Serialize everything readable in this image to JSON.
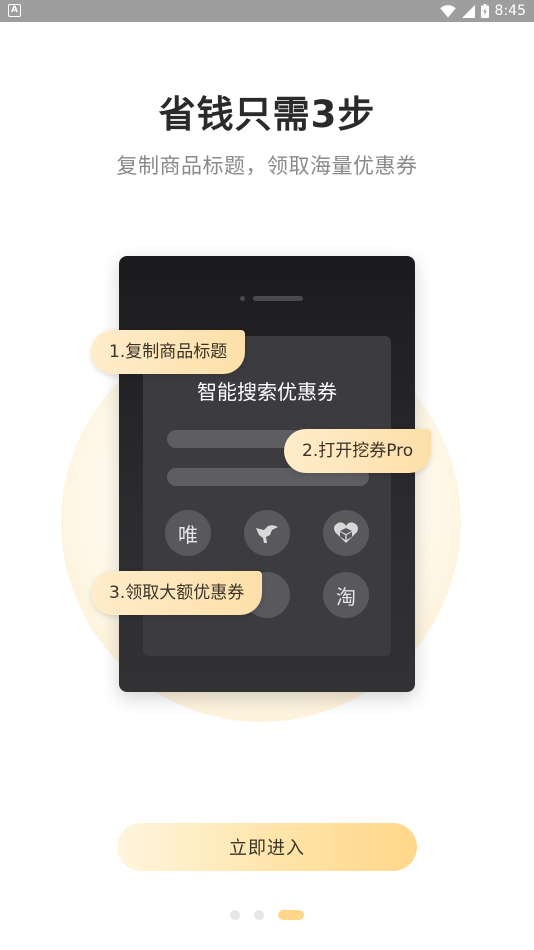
{
  "status_bar": {
    "time": "8:45",
    "app_icon_letter": "A",
    "icons": [
      "wifi-icon",
      "cellular-signal-icon",
      "battery-icon"
    ]
  },
  "header": {
    "title": "省钱只需3步",
    "subtitle": "复制商品标题，领取海量优惠券"
  },
  "phone": {
    "screen_title": "智能搜索优惠券",
    "apps": [
      {
        "label": "唯",
        "icon": "vip-icon"
      },
      {
        "label": "",
        "icon": "bird-icon"
      },
      {
        "label": "",
        "icon": "cube-logo-icon"
      },
      {
        "label": "",
        "icon": "app-icon-hidden"
      },
      {
        "label": "",
        "icon": "app-icon-hidden"
      },
      {
        "label": "淘",
        "icon": "taobao-icon"
      }
    ]
  },
  "steps": [
    {
      "label": "1.复制商品标题"
    },
    {
      "label": "2.打开挖券Pro"
    },
    {
      "label": "3.领取大额优惠券"
    }
  ],
  "enter_button": {
    "label": "立即进入"
  },
  "page_indicator": {
    "count": 3,
    "active_index": 2
  },
  "colors": {
    "accent": "#fde0a8",
    "button_gradient_end": "#ffd78a",
    "phone_body": "#2c2c2f",
    "status_bar": "#9e9e9e"
  }
}
